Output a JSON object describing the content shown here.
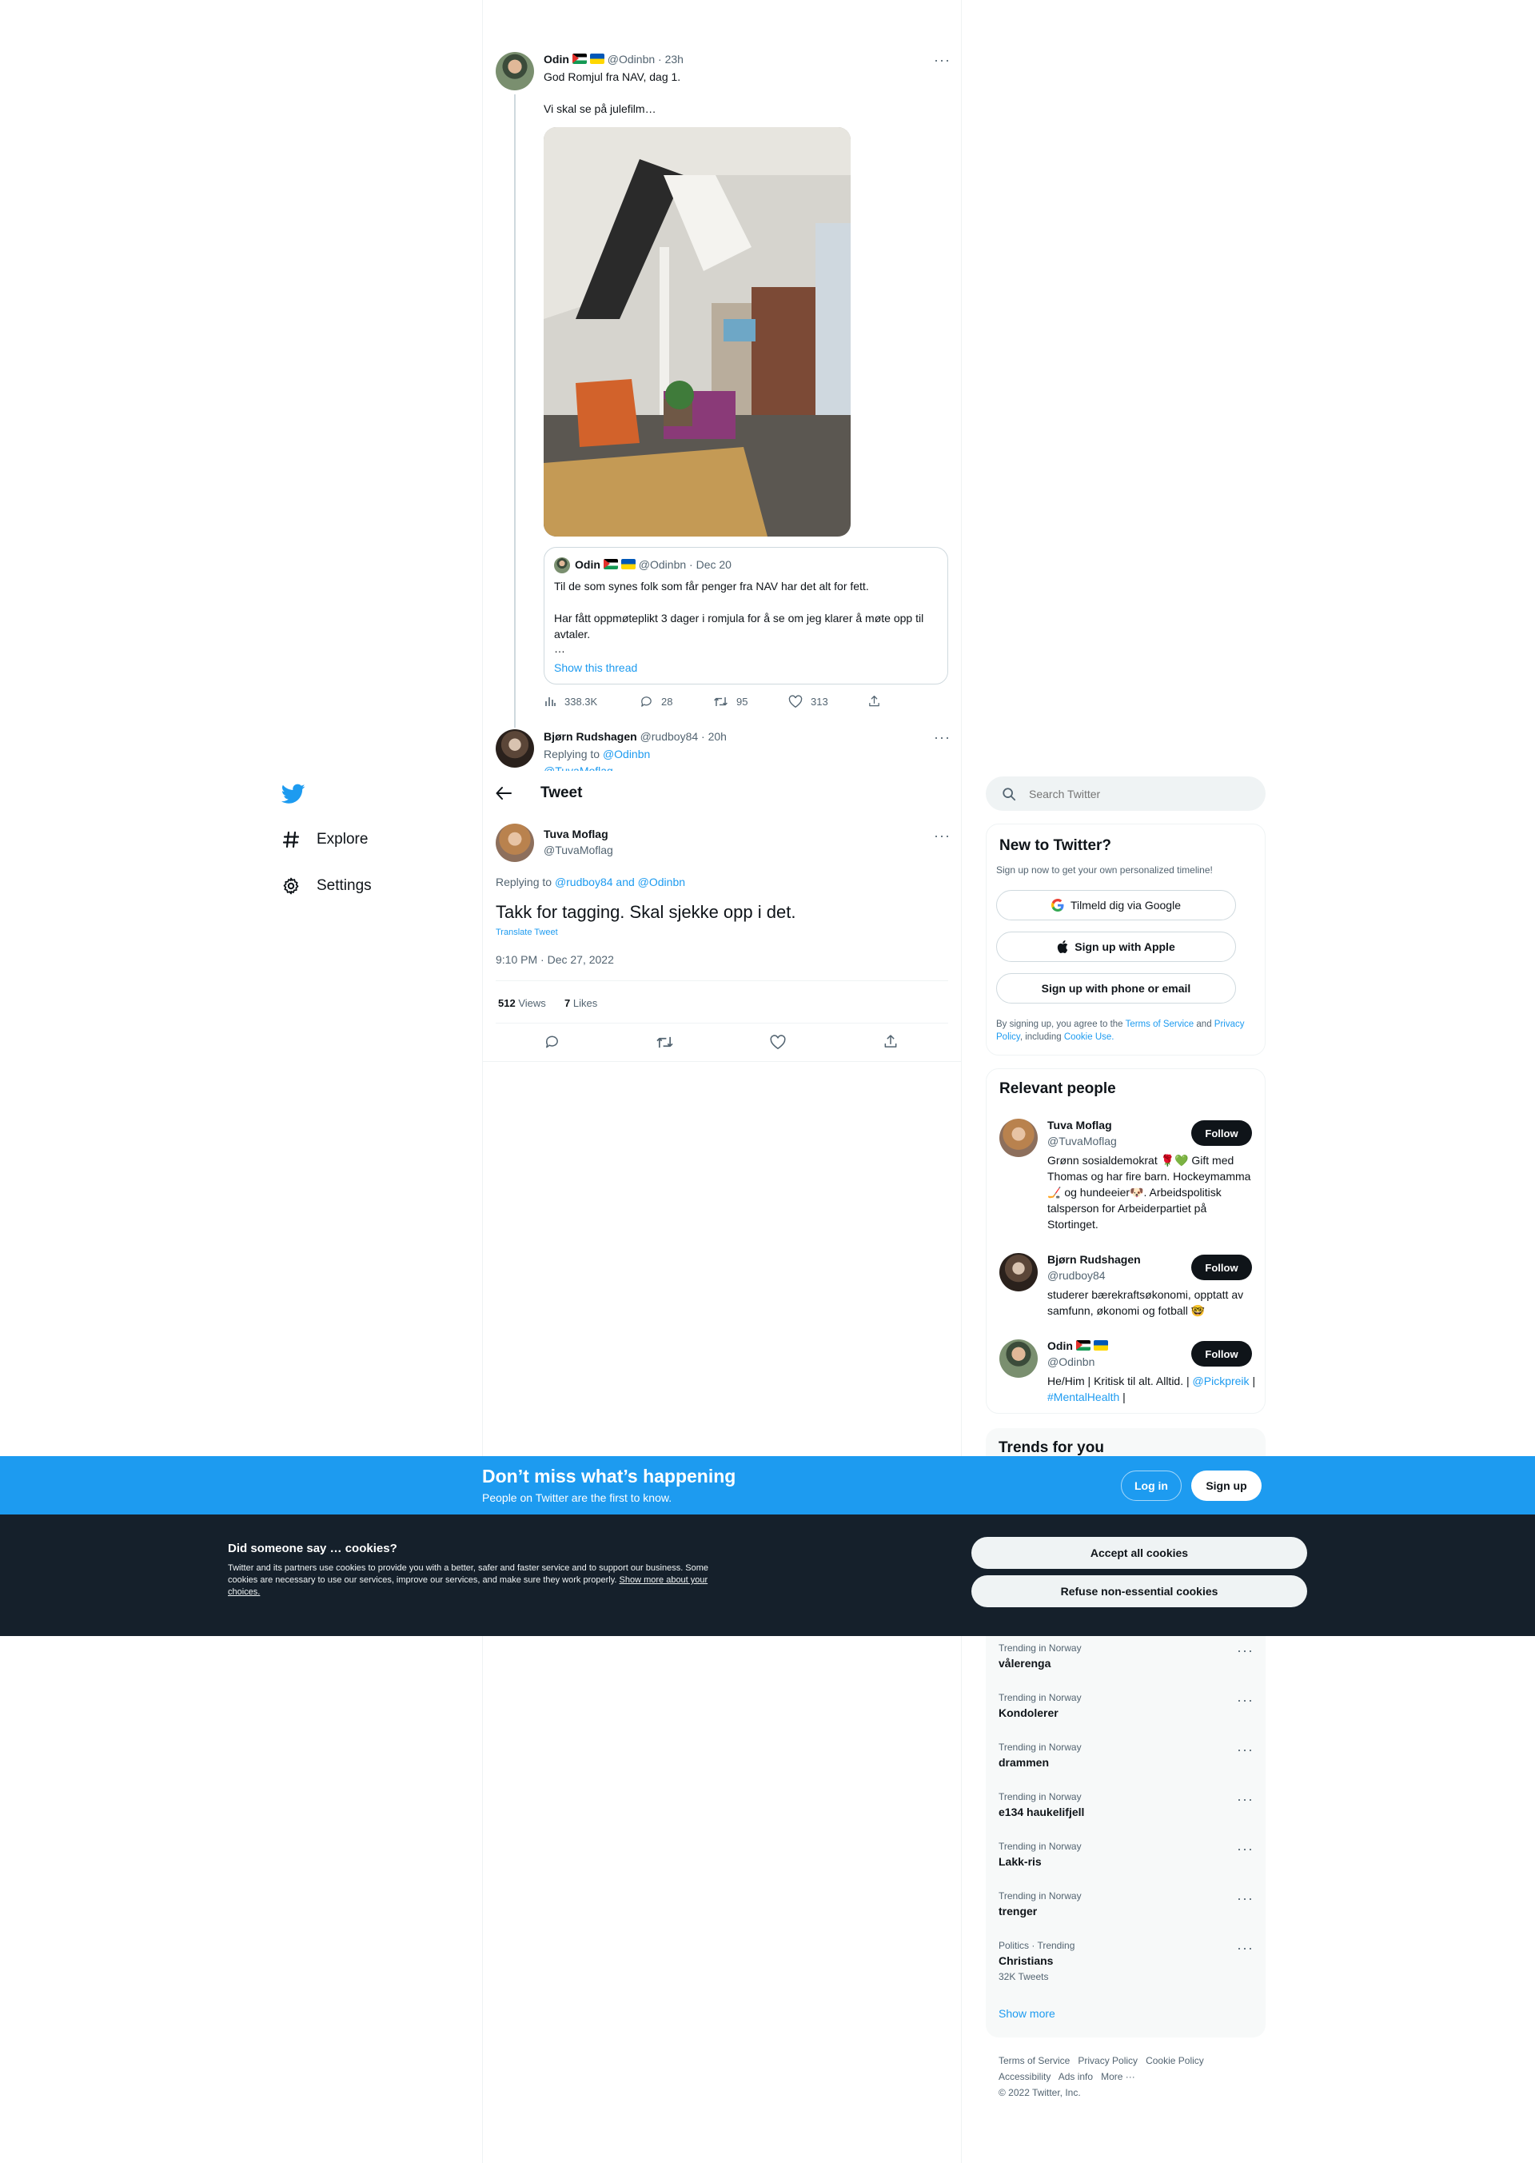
{
  "sidebar": {
    "nav": [
      {
        "label": "Explore",
        "icon": "hashtag-icon"
      },
      {
        "label": "Settings",
        "icon": "gear-icon"
      }
    ]
  },
  "thread": {
    "tweet1": {
      "name": "Odin",
      "handle": "@Odinbn",
      "time": "23h",
      "line1": "God Romjul fra NAV, dag 1.",
      "line2": "Vi skal se på julefilm…",
      "quote": {
        "name": "Odin",
        "handle": "@Odinbn",
        "time": "Dec 20",
        "line1": "Til de som synes folk som får penger fra NAV har det alt for fett.",
        "line2": "Har fått oppmøteplikt 3 dager i romjula for å se om jeg klarer å møte opp til avtaler.",
        "ellipsis": "…",
        "show_thread": "Show this thread"
      },
      "stats": {
        "views": "338.3K",
        "replies": "28",
        "retweets": "95",
        "likes": "313"
      }
    },
    "tweet2": {
      "name": "Bjørn Rudshagen",
      "handle": "@rudboy84",
      "time": "20h",
      "replying_to_label": "Replying to",
      "replying_to": "@Odinbn",
      "replying_to2": "@TuvaMoflag"
    }
  },
  "header": {
    "title": "Tweet"
  },
  "main_tweet": {
    "name": "Tuva Moflag",
    "handle": "@TuvaMoflag",
    "replying_label": "Replying to",
    "replying_users": "@rudboy84 and @Odinbn",
    "text": "Takk for tagging. Skal sjekke opp i det.",
    "translate": "Translate Tweet",
    "timestamp": "9:10 PM · Dec 27, 2022",
    "views_count": "512",
    "views_label": "Views",
    "likes_count": "7",
    "likes_label": "Likes"
  },
  "search": {
    "placeholder": "Search Twitter"
  },
  "new_to_twitter": {
    "title": "New to Twitter?",
    "subtitle": "Sign up now to get your own personalized timeline!",
    "google": "Tilmeld dig via Google",
    "apple": "Sign up with Apple",
    "phone": "Sign up with phone or email",
    "legal_1": "By signing up, you agree to the",
    "terms": "Terms of Service",
    "and": "and",
    "privacy": "Privacy Policy",
    "including": ", including",
    "cookie": "Cookie Use."
  },
  "relevant_people": {
    "title": "Relevant people",
    "follow_label": "Follow",
    "people": [
      {
        "name": "Tuva Moflag",
        "handle": "@TuvaMoflag",
        "bio": "Grønn sosialdemokrat 🌹💚 Gift med Thomas og har fire barn. Hockeymamma🏒 og hundeeier🐶. Arbeidspolitisk talsperson for Arbeiderpartiet på Stortinget."
      },
      {
        "name": "Bjørn Rudshagen",
        "handle": "@rudboy84",
        "bio": "studerer bærekraftsøkonomi, opptatt av samfunn, økonomi og fotball 🤓"
      },
      {
        "name": "Odin",
        "handle": "@Odinbn",
        "bio_1": "He/Him | Kritisk til alt. Alltid. |",
        "bio_link1": "@Pickpreik",
        "bio_sep": "|",
        "bio_link2": "#MentalHealth",
        "bio_end": "|"
      }
    ]
  },
  "trends": {
    "title": "Trends for you",
    "items": [
      {
        "category": "Trending in Norway",
        "name": "vålerenga"
      },
      {
        "category": "Trending in Norway",
        "name": "Kondolerer"
      },
      {
        "category": "Trending in Norway",
        "name": "drammen"
      },
      {
        "category": "Trending in Norway",
        "name": "e134 haukelifjell"
      },
      {
        "category": "Trending in Norway",
        "name": "Lakk-ris"
      },
      {
        "category": "Trending in Norway",
        "name": "trenger"
      },
      {
        "category": "Politics · Trending",
        "name": "Christians",
        "count": "32K Tweets"
      }
    ],
    "show_more": "Show more"
  },
  "footer": {
    "terms": "Terms of Service",
    "privacy": "Privacy Policy",
    "cookie": "Cookie Policy",
    "accessibility": "Accessibility",
    "ads": "Ads info",
    "more": "More ···",
    "copyright": "© 2022 Twitter, Inc."
  },
  "banner": {
    "title": "Don’t miss what’s happening",
    "subtitle": "People on Twitter are the first to know.",
    "login": "Log in",
    "signup": "Sign up"
  },
  "cookies": {
    "title": "Did someone say … cookies?",
    "body": "Twitter and its partners use cookies to provide you with a better, safer and faster service and to support our business. Some cookies are necessary to use our services, improve our services, and make sure they work properly.",
    "link": "Show more about your choices.",
    "accept": "Accept all cookies",
    "refuse": "Refuse non-essential cookies"
  },
  "colors": {
    "accent": "#1d9bf0",
    "dark": "#0f1419",
    "muted": "#536471",
    "banner": "#1d9bf0"
  }
}
